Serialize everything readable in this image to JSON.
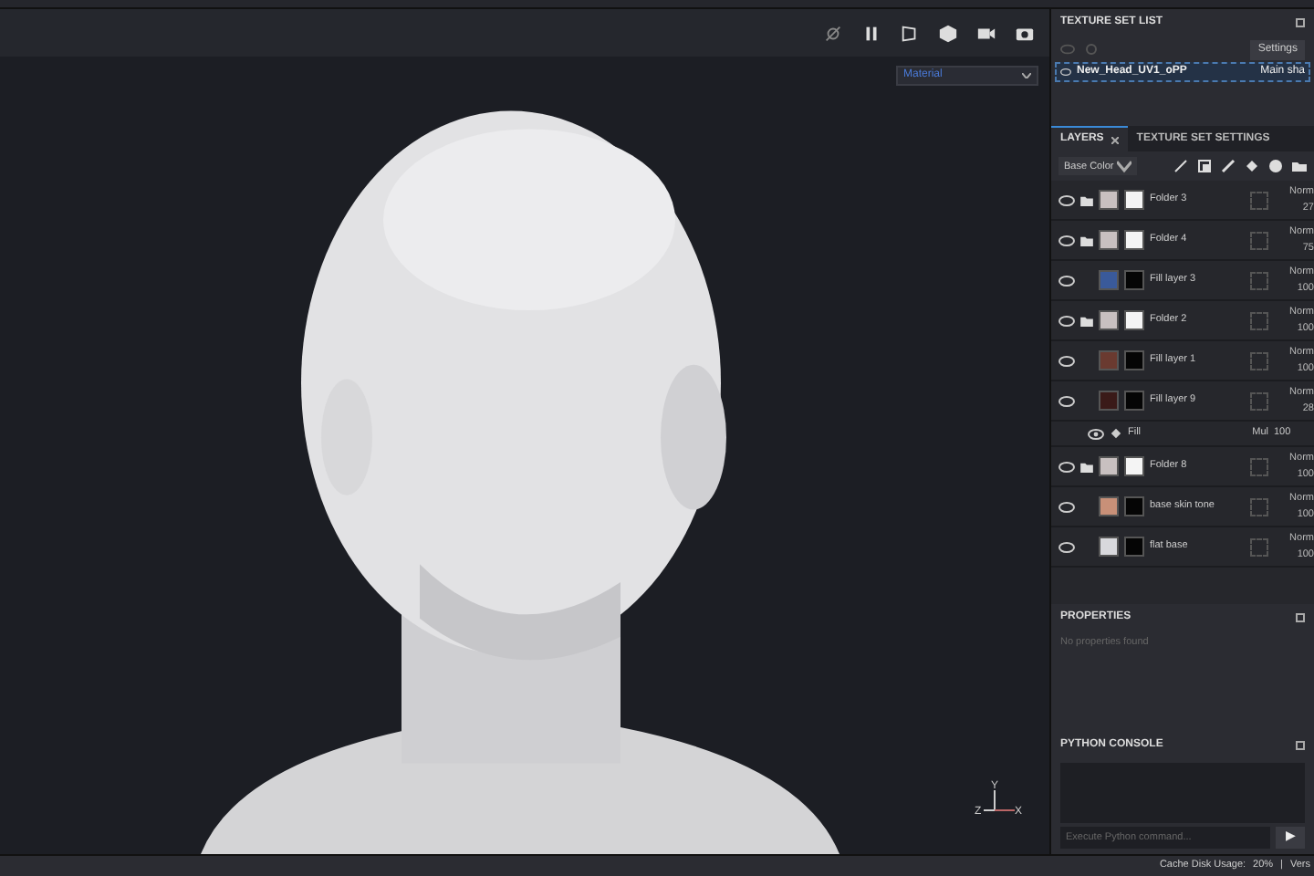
{
  "viewport": {
    "mode_dropdown": "Material",
    "axis_labels": [
      "Y",
      "Z",
      "X"
    ]
  },
  "texture_set_list": {
    "title": "TEXTURE SET LIST",
    "settings_button": "Settings",
    "items": [
      {
        "name": "New_Head_UV1_oPP",
        "shader": "Main sha",
        "selected": true
      }
    ]
  },
  "tabs": [
    {
      "label": "LAYERS",
      "selected": true,
      "closable": true
    },
    {
      "label": "TEXTURE SET SETTINGS",
      "selected": false,
      "closable": false
    }
  ],
  "channel_dropdown": "Base Color",
  "layers": [
    {
      "kind": "folder",
      "name": "Folder 3",
      "blend": "Norm",
      "opacity": "27",
      "visible": true
    },
    {
      "kind": "folder",
      "name": "Folder 4",
      "blend": "Norm",
      "opacity": "75",
      "visible": true
    },
    {
      "kind": "fill",
      "name": "Fill layer 3",
      "blend": "Norm",
      "opacity": "100",
      "visible": true,
      "color": "#3a5a9a"
    },
    {
      "kind": "folder",
      "name": "Folder 2",
      "blend": "Norm",
      "opacity": "100",
      "visible": true
    },
    {
      "kind": "fill",
      "name": "Fill layer 1",
      "blend": "Norm",
      "opacity": "100",
      "visible": true,
      "color": "#6a3a30"
    },
    {
      "kind": "fill",
      "name": "Fill layer 9",
      "blend": "Norm",
      "opacity": "28",
      "visible": true,
      "color": "#3a1a18"
    },
    {
      "kind": "effect",
      "name": "Fill",
      "blend": "Mul",
      "opacity": "100",
      "visible": true
    },
    {
      "kind": "folder",
      "name": "Folder 8",
      "blend": "Norm",
      "opacity": "100",
      "visible": true
    },
    {
      "kind": "fill",
      "name": "base skin tone",
      "blend": "Norm",
      "opacity": "100",
      "visible": true,
      "color": "#c89078"
    },
    {
      "kind": "fill",
      "name": "flat base",
      "blend": "Norm",
      "opacity": "100",
      "visible": true,
      "color": "#d8d8dc"
    }
  ],
  "properties": {
    "title": "PROPERTIES",
    "empty_text": "No properties found"
  },
  "python_console": {
    "title": "PYTHON CONSOLE",
    "placeholder": "Execute Python command...",
    "run_button": "▶"
  },
  "status_bar": {
    "cache_label": "Cache Disk Usage:",
    "cache_value": "20%",
    "separator": "|",
    "version_label": "Vers"
  }
}
